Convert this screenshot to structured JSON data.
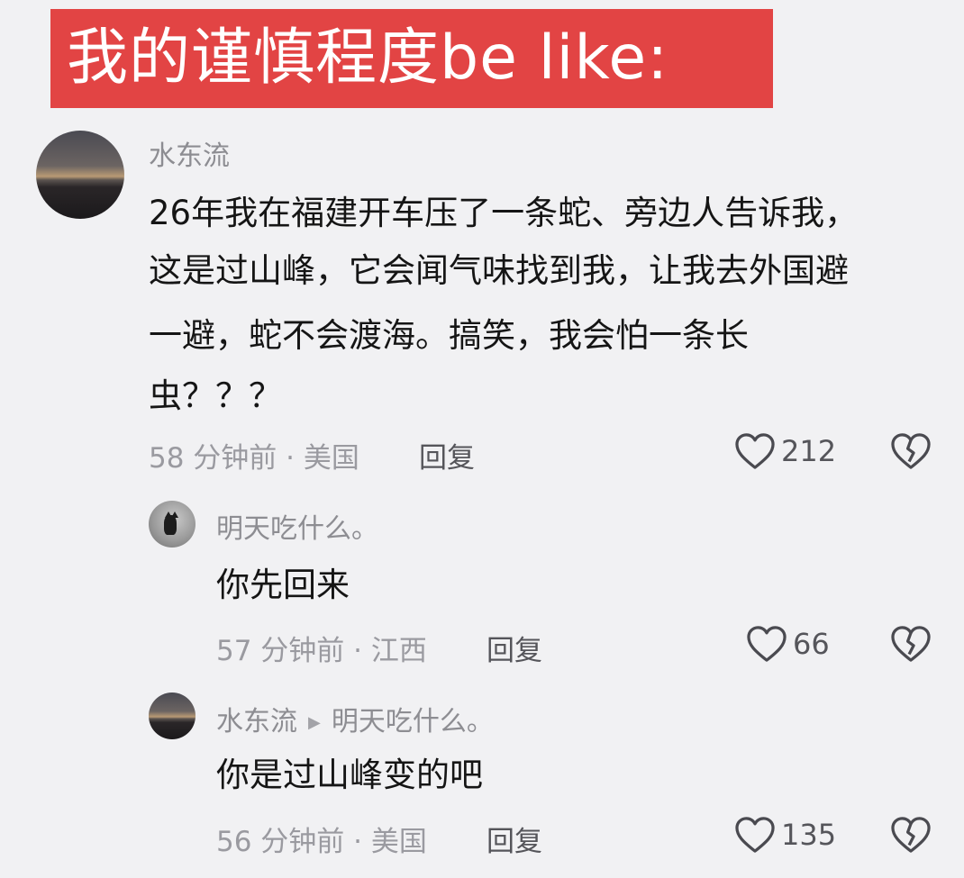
{
  "banner": {
    "text": "我的谨慎程度be like:"
  },
  "comments": [
    {
      "username": "水东流",
      "lines": [
        "26年我在福建开车压了一条蛇、旁边人告诉我，",
        "这是过山峰，它会闻气味找到我，让我去外国避",
        "一避，蛇不会渡海。搞笑，我会怕一条长",
        "虫？？？"
      ],
      "meta": "58 分钟前 · 美国",
      "reply_label": "回复",
      "likes": "212",
      "icons": {
        "avatar": "sunset-avatar",
        "like": "heart-icon",
        "dislike": "broken-heart-icon"
      }
    },
    {
      "username": "明天吃什么。",
      "lines": [
        "你先回来"
      ],
      "meta": "57 分钟前 · 江西",
      "reply_label": "回复",
      "likes": "66",
      "icons": {
        "avatar": "cat-avatar",
        "like": "heart-icon",
        "dislike": "broken-heart-icon"
      }
    },
    {
      "username": "水东流",
      "reply_to": "明天吃什么。",
      "lines": [
        "你是过山峰变的吧"
      ],
      "meta": "56 分钟前 · 美国",
      "reply_label": "回复",
      "likes": "135",
      "icons": {
        "avatar": "sunset-avatar",
        "like": "heart-icon",
        "dislike": "broken-heart-icon"
      }
    }
  ],
  "colors": {
    "banner_bg": "#e24444",
    "background": "#f1f1f3",
    "muted_text": "#9a9aa0"
  }
}
